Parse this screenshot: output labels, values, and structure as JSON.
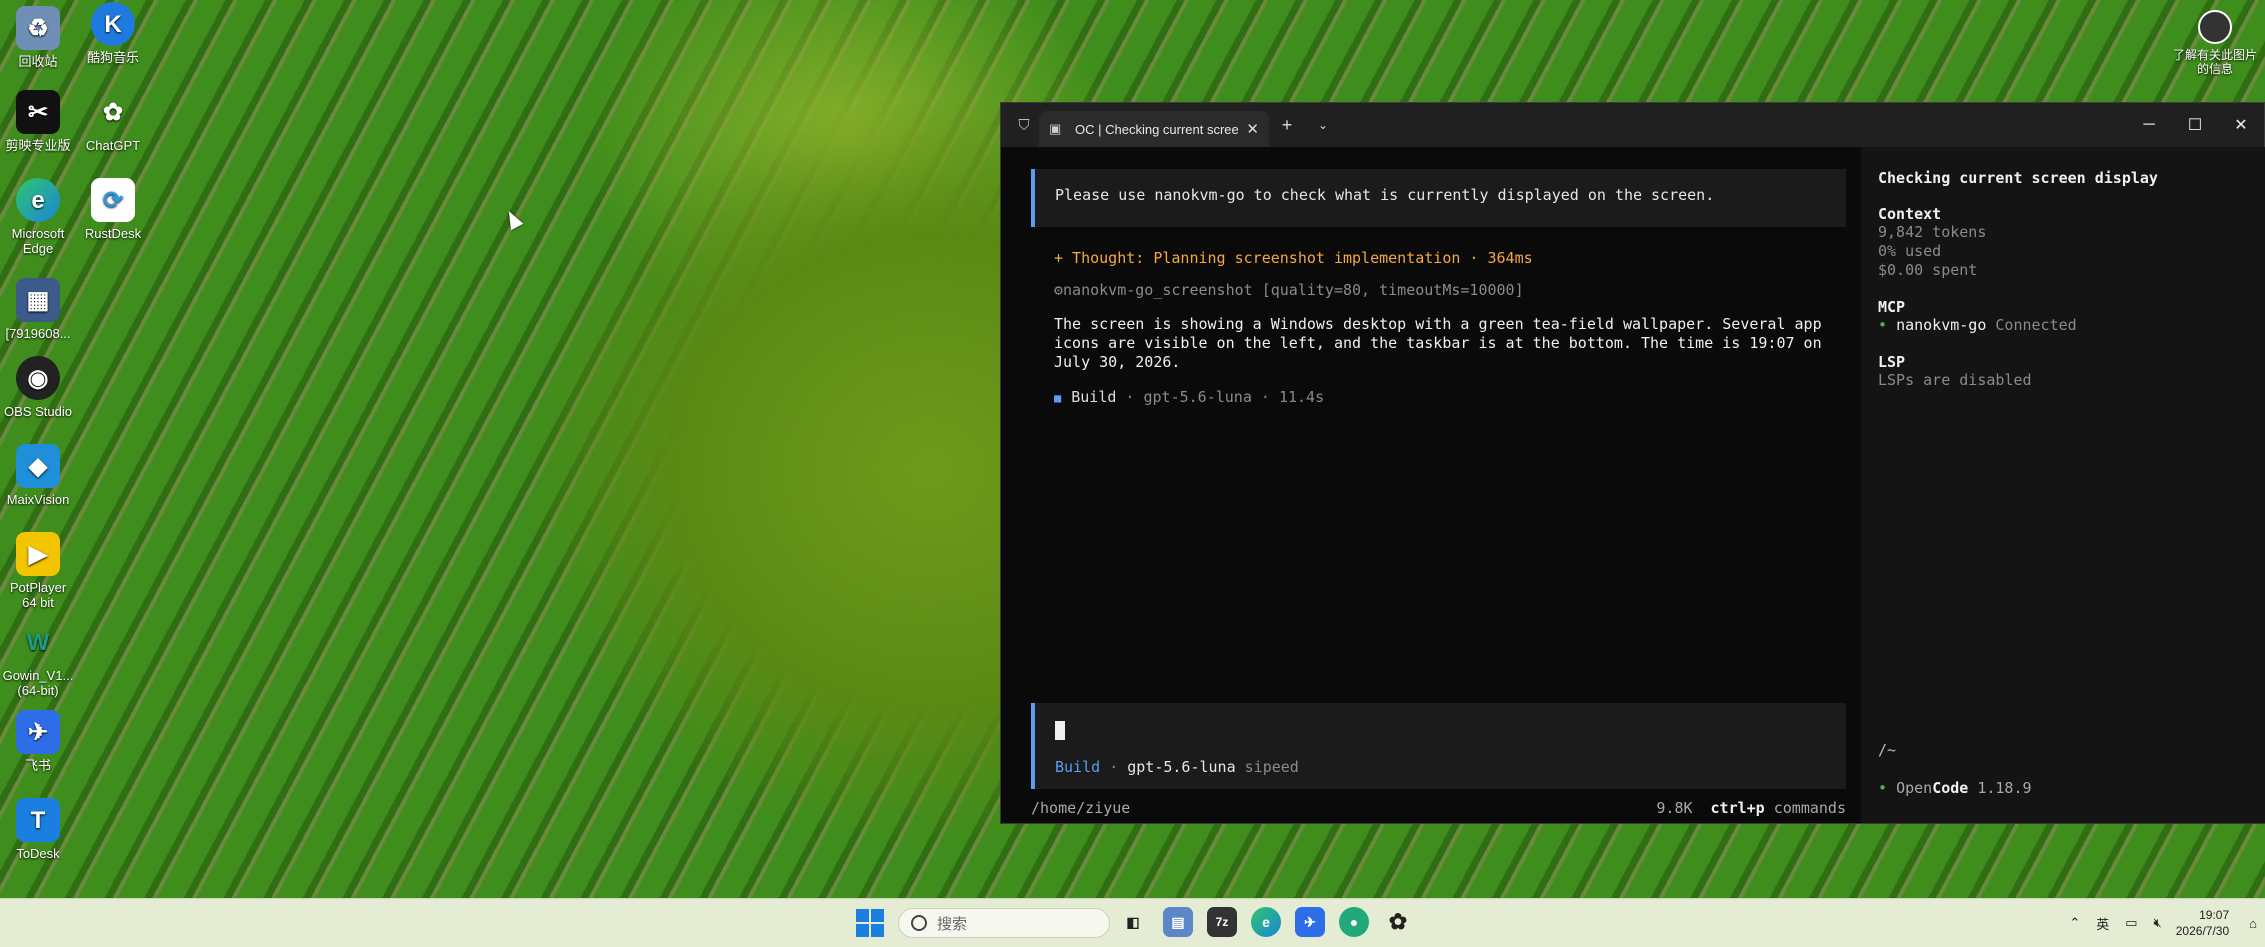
{
  "desktop": {
    "icons": [
      {
        "label": "回收站",
        "icon": "recycle-bin-icon",
        "color": "#3a6fb0"
      },
      {
        "label": "酷狗音乐",
        "icon": "kugou-icon",
        "color": "#1f7ae0"
      },
      {
        "label": "剪映专业版",
        "icon": "capcut-icon",
        "color": "#111111"
      },
      {
        "label": "ChatGPT",
        "icon": "chatgpt-icon",
        "color": "#2e2e2e"
      },
      {
        "label": "Microsoft Edge",
        "icon": "edge-icon",
        "color": "#1b86d8"
      },
      {
        "label": "RustDesk",
        "icon": "rustdesk-icon",
        "color": "#2a9ae0"
      },
      {
        "label": "[7919608...",
        "icon": "file-icon",
        "color": "#3c5a8a"
      },
      {
        "label": "OBS Studio",
        "icon": "obs-icon",
        "color": "#222222"
      },
      {
        "label": "MaixVision",
        "icon": "maixvision-icon",
        "color": "#1f8fd9"
      },
      {
        "label": "PotPlayer 64 bit",
        "icon": "potplayer-icon",
        "color": "#f3c400"
      },
      {
        "label": "Gowin_V1... (64-bit)",
        "icon": "gowin-icon",
        "color": "#1e9a87"
      },
      {
        "label": "飞书",
        "icon": "feishu-icon",
        "color": "#2e6de8"
      },
      {
        "label": "ToDesk",
        "icon": "todesk-icon",
        "color": "#1a7fe0"
      }
    ],
    "info_label": "了解有关此图片的信息"
  },
  "window": {
    "tab_title": "OC | Checking current screen d",
    "conversation": {
      "user_prompt": "Please use nanokvm-go to check what is currently displayed on the screen.",
      "thought": "+ Thought: Planning screenshot implementation · 364ms",
      "tool_call": "⚙nanokvm-go_screenshot [quality=80, timeoutMs=10000]",
      "answer": "The screen is showing a Windows desktop with a green tea-field wallpaper. Several app icons are visible on the left, and the taskbar is at the bottom. The time is 19:07 on July 30, 2026.",
      "build_label": "Build",
      "build_meta": "· gpt-5.6-luna · 11.4s"
    },
    "input": {
      "mode": "Build",
      "model": "gpt-5.6-luna",
      "provider": "sipeed"
    },
    "footer": {
      "cwd": "/home/ziyue",
      "tokens": "9.8K",
      "shortcut": "ctrl+p",
      "shortcut_label": "commands"
    },
    "sidebar": {
      "title": "Checking current screen display",
      "context_heading": "Context",
      "context_tokens": "9,842 tokens",
      "context_used": "0% used",
      "context_spent": "$0.00 spent",
      "mcp_heading": "MCP",
      "mcp_server": "nanokvm-go",
      "mcp_status": "Connected",
      "lsp_heading": "LSP",
      "lsp_status": "LSPs are disabled",
      "path": "/~",
      "brand_open": "Open",
      "brand_code": "Code",
      "version": "1.18.9"
    }
  },
  "taskbar": {
    "search_placeholder": "搜索",
    "ime": "英",
    "time": "19:07",
    "date": "2026/7/30"
  }
}
